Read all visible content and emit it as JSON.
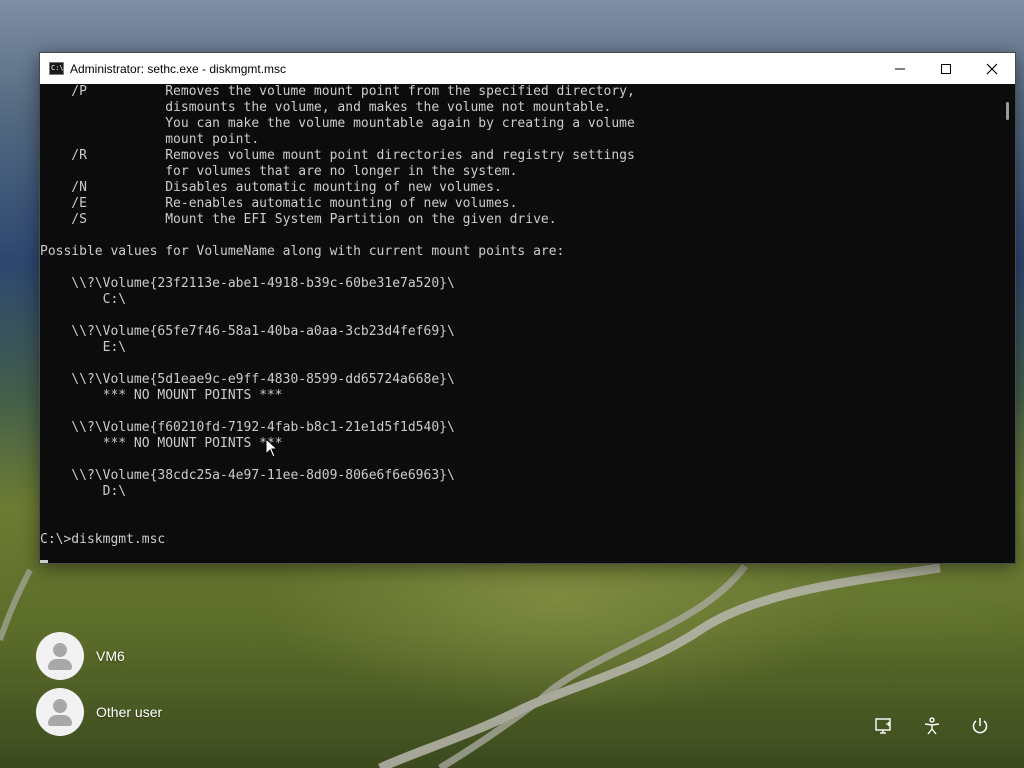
{
  "window": {
    "title": "Administrator: sethc.exe - diskmgmt.msc",
    "icon_text": "C:\\"
  },
  "console": {
    "lines": [
      "    /P          Removes the volume mount point from the specified directory,",
      "                dismounts the volume, and makes the volume not mountable.",
      "                You can make the volume mountable again by creating a volume",
      "                mount point.",
      "    /R          Removes volume mount point directories and registry settings",
      "                for volumes that are no longer in the system.",
      "    /N          Disables automatic mounting of new volumes.",
      "    /E          Re-enables automatic mounting of new volumes.",
      "    /S          Mount the EFI System Partition on the given drive.",
      "",
      "Possible values for VolumeName along with current mount points are:",
      "",
      "    \\\\?\\Volume{23f2113e-abe1-4918-b39c-60be31e7a520}\\",
      "        C:\\",
      "",
      "    \\\\?\\Volume{65fe7f46-58a1-40ba-a0aa-3cb23d4fef69}\\",
      "        E:\\",
      "",
      "    \\\\?\\Volume{5d1eae9c-e9ff-4830-8599-dd65724a668e}\\",
      "        *** NO MOUNT POINTS ***",
      "",
      "    \\\\?\\Volume{f60210fd-7192-4fab-b8c1-21e1d5f1d540}\\",
      "        *** NO MOUNT POINTS ***",
      "",
      "    \\\\?\\Volume{38cdc25a-4e97-11ee-8d09-806e6f6e6963}\\",
      "        D:\\",
      "",
      "",
      "C:\\>diskmgmt.msc"
    ]
  },
  "users": [
    {
      "name": "VM6"
    },
    {
      "name": "Other user"
    }
  ],
  "tray": {
    "network_icon": "network-icon",
    "accessibility_icon": "accessibility-icon",
    "power_icon": "power-icon"
  }
}
